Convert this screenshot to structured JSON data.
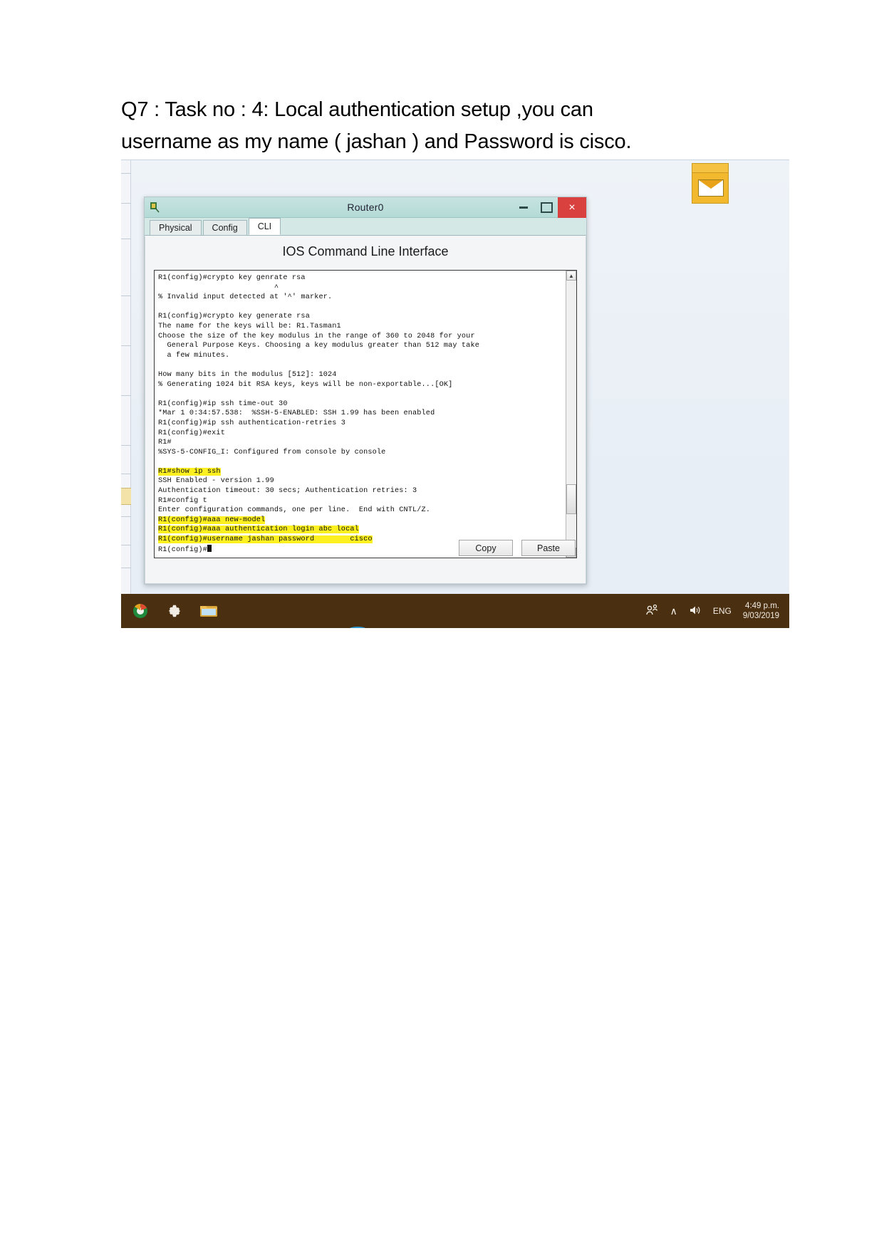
{
  "document": {
    "heading_line1": "Q7 : Task no : 4: Local authentication setup ,you can",
    "heading_line2": "username as my name ( jashan ) and Password is cisco."
  },
  "window": {
    "title": "Router0",
    "icon": "router-device-icon",
    "controls": {
      "minimize": "–",
      "maximize": "❐",
      "close": "×"
    },
    "tabs": [
      {
        "label": "Physical",
        "active": false
      },
      {
        "label": "Config",
        "active": false
      },
      {
        "label": "CLI",
        "active": true
      }
    ],
    "cli_header": "IOS Command Line Interface",
    "buttons": {
      "copy": "Copy",
      "paste": "Paste"
    },
    "scrollbar": {
      "up_arrow": "▲",
      "down_arrow": "▼"
    }
  },
  "terminal": {
    "lines": [
      {
        "text": "R1(config)#crypto key genrate rsa",
        "highlight": false
      },
      {
        "text": "                          ^",
        "highlight": false
      },
      {
        "text": "% Invalid input detected at '^' marker.",
        "highlight": false
      },
      {
        "text": "",
        "highlight": false
      },
      {
        "text": "R1(config)#crypto key generate rsa",
        "highlight": false
      },
      {
        "text": "The name for the keys will be: R1.Tasman1",
        "highlight": false
      },
      {
        "text": "Choose the size of the key modulus in the range of 360 to 2048 for your",
        "highlight": false
      },
      {
        "text": "  General Purpose Keys. Choosing a key modulus greater than 512 may take",
        "highlight": false
      },
      {
        "text": "  a few minutes.",
        "highlight": false
      },
      {
        "text": "",
        "highlight": false
      },
      {
        "text": "How many bits in the modulus [512]: 1024",
        "highlight": false
      },
      {
        "text": "% Generating 1024 bit RSA keys, keys will be non-exportable...[OK]",
        "highlight": false
      },
      {
        "text": "",
        "highlight": false
      },
      {
        "text": "R1(config)#ip ssh time-out 30",
        "highlight": false
      },
      {
        "text": "*Mar 1 0:34:57.538:  %SSH-5-ENABLED: SSH 1.99 has been enabled",
        "highlight": false
      },
      {
        "text": "R1(config)#ip ssh authentication-retries 3",
        "highlight": false
      },
      {
        "text": "R1(config)#exit",
        "highlight": false
      },
      {
        "text": "R1#",
        "highlight": false
      },
      {
        "text": "%SYS-5-CONFIG_I: Configured from console by console",
        "highlight": false
      },
      {
        "text": "",
        "highlight": false
      },
      {
        "text": "R1#show ip ssh",
        "highlight": true
      },
      {
        "text": "SSH Enabled - version 1.99",
        "highlight": false
      },
      {
        "text": "Authentication timeout: 30 secs; Authentication retries: 3",
        "highlight": false
      },
      {
        "text": "R1#config t",
        "highlight": false
      },
      {
        "text": "Enter configuration commands, one per line.  End with CNTL/Z.",
        "highlight": false
      },
      {
        "text": "R1(config)#aaa new-model",
        "highlight": true
      },
      {
        "text": "R1(config)#aaa authentication login abc local",
        "highlight": true
      },
      {
        "text": "R1(config)#username jashan password        cisco",
        "highlight": true
      },
      {
        "text": "R1(config)#",
        "highlight": false
      }
    ]
  },
  "taskbar": {
    "icons": [
      "packet-tracer-icon",
      "settings-gear-icon",
      "file-explorer-icon"
    ],
    "tray": {
      "network_user_icon": "people-network-icon",
      "chevron_up_icon": "∧",
      "volume_icon": "speaker-icon",
      "language": "ENG",
      "time": "4:49 p.m.",
      "date": "9/03/2019"
    }
  },
  "colors": {
    "titlebar": "#b9ded9",
    "close_button": "#d9413e",
    "highlight": "#fdf021",
    "taskbar": "#4a2f10",
    "workspace": "#eaf0f7"
  }
}
